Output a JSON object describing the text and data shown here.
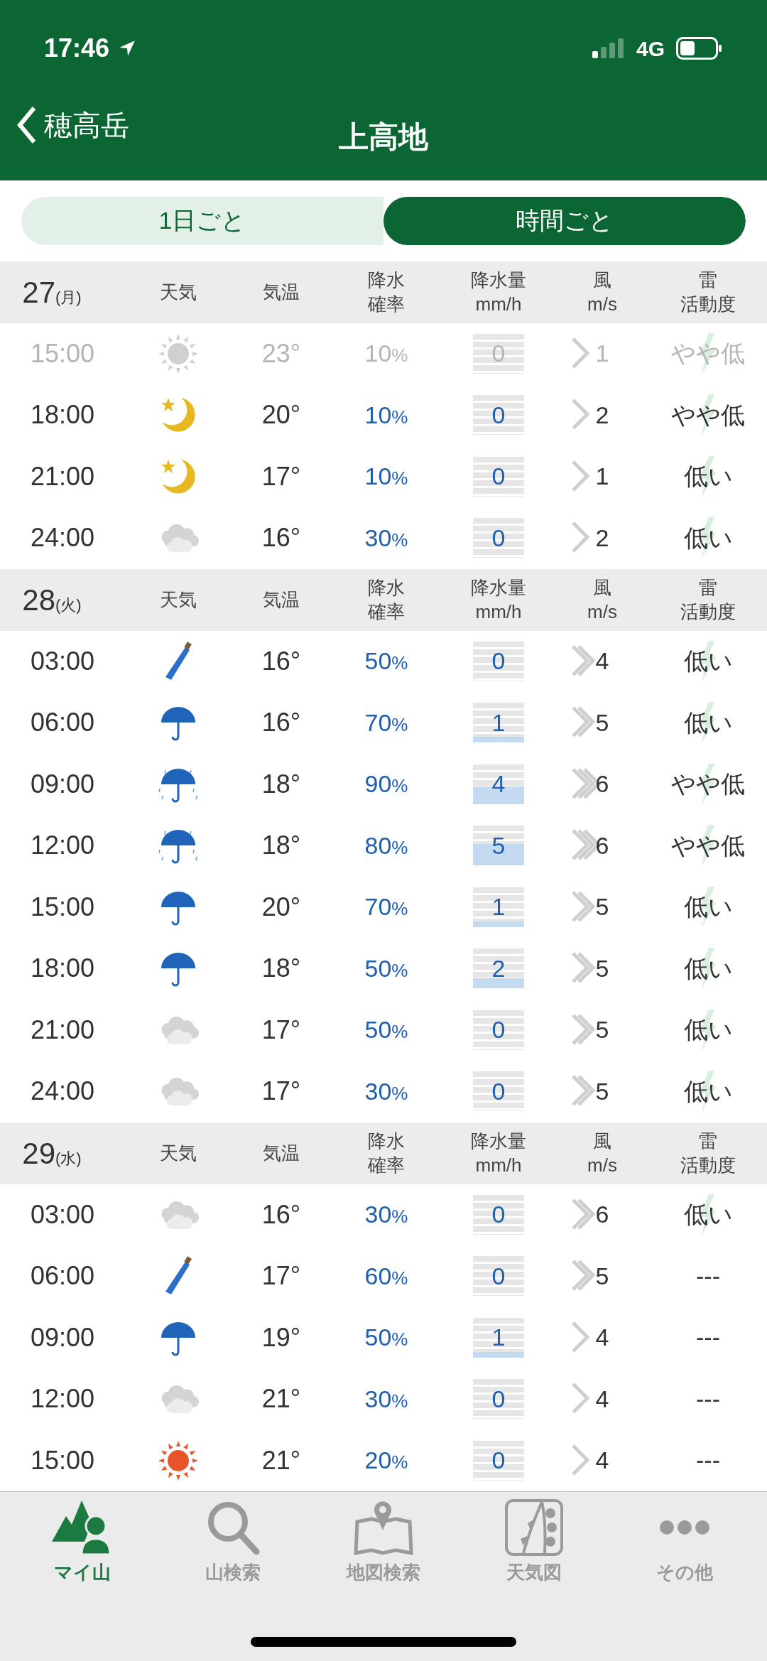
{
  "status_bar": {
    "time": "17:46",
    "network": "4G"
  },
  "nav": {
    "back": "穂高岳",
    "title": "上高地"
  },
  "tabs": [
    {
      "label": "1日ごと",
      "selected": false
    },
    {
      "label": "時間ごと",
      "selected": true
    }
  ],
  "days": [
    {
      "date": "27",
      "weekday": "(月)",
      "columns": [
        [
          "天気"
        ],
        [
          "気温"
        ],
        [
          "降水",
          "確率"
        ],
        [
          "降水量",
          "mm/h"
        ],
        [
          "風",
          "m/s"
        ],
        [
          "雷",
          "活動度"
        ]
      ],
      "rows": [
        {
          "time": "15:00",
          "past": true,
          "weather": {
            "kind": "sun"
          },
          "temp": "23°",
          "pop": "10%",
          "precip": "0",
          "wind": {
            "speed": "1",
            "kind": "single"
          },
          "thunder": "やや低",
          "lightning": true
        },
        {
          "time": "18:00",
          "past": false,
          "weather": {
            "kind": "moon"
          },
          "temp": "20°",
          "pop": "10%",
          "precip": "0",
          "wind": {
            "speed": "2",
            "kind": "single"
          },
          "thunder": "やや低",
          "lightning": true
        },
        {
          "time": "21:00",
          "past": false,
          "weather": {
            "kind": "moon"
          },
          "temp": "17°",
          "pop": "10%",
          "precip": "0",
          "wind": {
            "speed": "1",
            "kind": "single"
          },
          "thunder": "低い",
          "lightning": true
        },
        {
          "time": "24:00",
          "past": false,
          "weather": {
            "kind": "cloud"
          },
          "temp": "16°",
          "pop": "30%",
          "precip": "0",
          "wind": {
            "speed": "2",
            "kind": "single"
          },
          "thunder": "低い",
          "lightning": true
        }
      ]
    },
    {
      "date": "28",
      "weekday": "(火)",
      "columns": [
        [
          "天気"
        ],
        [
          "気温"
        ],
        [
          "降水",
          "確率"
        ],
        [
          "降水量",
          "mm/h"
        ],
        [
          "風",
          "m/s"
        ],
        [
          "雷",
          "活動度"
        ]
      ],
      "rows": [
        {
          "time": "03:00",
          "past": false,
          "weather": {
            "kind": "umbrella-closed"
          },
          "temp": "16°",
          "pop": "50%",
          "precip": "0",
          "wind": {
            "speed": "4",
            "kind": "double"
          },
          "thunder": "低い",
          "lightning": true
        },
        {
          "time": "06:00",
          "past": false,
          "weather": {
            "kind": "umbrella"
          },
          "temp": "16°",
          "pop": "70%",
          "precip": "1",
          "wind": {
            "speed": "5",
            "kind": "double"
          },
          "thunder": "低い",
          "lightning": true
        },
        {
          "time": "09:00",
          "past": false,
          "weather": {
            "kind": "umbrella-rain"
          },
          "temp": "18°",
          "pop": "90%",
          "precip": "4",
          "wind": {
            "speed": "6",
            "kind": "triple"
          },
          "thunder": "やや低",
          "lightning": true
        },
        {
          "time": "12:00",
          "past": false,
          "weather": {
            "kind": "umbrella-rain"
          },
          "temp": "18°",
          "pop": "80%",
          "precip": "5",
          "wind": {
            "speed": "6",
            "kind": "triple"
          },
          "thunder": "やや低",
          "lightning": true
        },
        {
          "time": "15:00",
          "past": false,
          "weather": {
            "kind": "umbrella"
          },
          "temp": "20°",
          "pop": "70%",
          "precip": "1",
          "wind": {
            "speed": "5",
            "kind": "double"
          },
          "thunder": "低い",
          "lightning": true
        },
        {
          "time": "18:00",
          "past": false,
          "weather": {
            "kind": "umbrella"
          },
          "temp": "18°",
          "pop": "50%",
          "precip": "2",
          "wind": {
            "speed": "5",
            "kind": "double"
          },
          "thunder": "低い",
          "lightning": true
        },
        {
          "time": "21:00",
          "past": false,
          "weather": {
            "kind": "cloud"
          },
          "temp": "17°",
          "pop": "50%",
          "precip": "0",
          "wind": {
            "speed": "5",
            "kind": "double"
          },
          "thunder": "低い",
          "lightning": true
        },
        {
          "time": "24:00",
          "past": false,
          "weather": {
            "kind": "cloud"
          },
          "temp": "17°",
          "pop": "30%",
          "precip": "0",
          "wind": {
            "speed": "5",
            "kind": "double"
          },
          "thunder": "低い",
          "lightning": true
        }
      ]
    },
    {
      "date": "29",
      "weekday": "(水)",
      "columns": [
        [
          "天気"
        ],
        [
          "気温"
        ],
        [
          "降水",
          "確率"
        ],
        [
          "降水量",
          "mm/h"
        ],
        [
          "風",
          "m/s"
        ],
        [
          "雷",
          "活動度"
        ]
      ],
      "rows": [
        {
          "time": "03:00",
          "past": false,
          "weather": {
            "kind": "cloud"
          },
          "temp": "16°",
          "pop": "30%",
          "precip": "0",
          "wind": {
            "speed": "6",
            "kind": "double"
          },
          "thunder": "低い",
          "lightning": true
        },
        {
          "time": "06:00",
          "past": false,
          "weather": {
            "kind": "umbrella-closed"
          },
          "temp": "17°",
          "pop": "60%",
          "precip": "0",
          "wind": {
            "speed": "5",
            "kind": "double"
          },
          "thunder": "---",
          "lightning": false
        },
        {
          "time": "09:00",
          "past": false,
          "weather": {
            "kind": "umbrella"
          },
          "temp": "19°",
          "pop": "50%",
          "precip": "1",
          "wind": {
            "speed": "4",
            "kind": "single"
          },
          "thunder": "---",
          "lightning": false
        },
        {
          "time": "12:00",
          "past": false,
          "weather": {
            "kind": "cloud"
          },
          "temp": "21°",
          "pop": "30%",
          "precip": "0",
          "wind": {
            "speed": "4",
            "kind": "single"
          },
          "thunder": "---",
          "lightning": false
        },
        {
          "time": "15:00",
          "past": false,
          "weather": {
            "kind": "sun-hot"
          },
          "temp": "21°",
          "pop": "20%",
          "precip": "0",
          "wind": {
            "speed": "4",
            "kind": "single"
          },
          "thunder": "---",
          "lightning": false
        }
      ]
    }
  ],
  "tab_bar": [
    {
      "label": "マイ山",
      "selected": true
    },
    {
      "label": "山検索",
      "selected": false
    },
    {
      "label": "地図検索",
      "selected": false
    },
    {
      "label": "天気図",
      "selected": false
    },
    {
      "label": "その他",
      "selected": false
    }
  ]
}
